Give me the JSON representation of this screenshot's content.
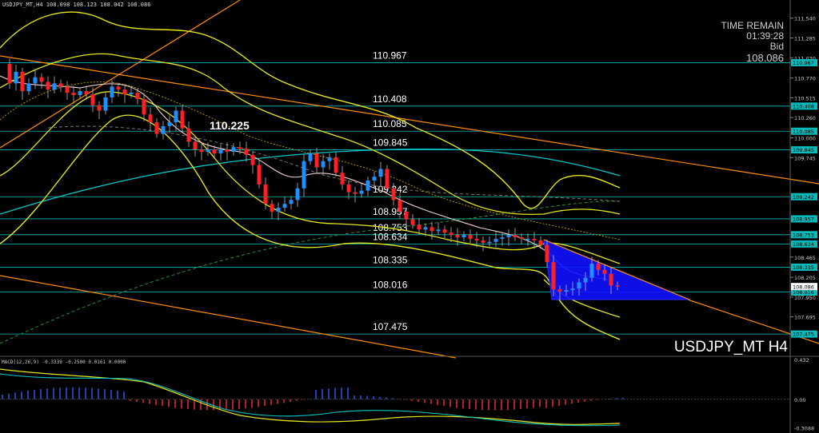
{
  "window": {
    "header": "USDJPY_MT,H4  108.098 108.123 108.042 108.086",
    "symbol_label": "USDJPY_MT H4"
  },
  "info_box": {
    "line1": "TIME REMAIN",
    "line2": "01:39:28",
    "line3": "Bid",
    "line4": "108.086"
  },
  "colors": {
    "background": "#000000",
    "bull_candle": "#1e90ff",
    "bear_candle": "#ff2020",
    "level_line": "#00bcbc",
    "band": "#e6e619",
    "trend": "#ff8c00",
    "ma_slow": "#00c8c8",
    "triangle": "#1010ff",
    "macd_hist_pos": "#3060ff",
    "macd_hist_neg": "#ff3030"
  },
  "chart_data": {
    "type": "candlestick",
    "price_axis_ticks": [
      "111.540",
      "111.285",
      "111.030",
      "110.770",
      "110.515",
      "110.260",
      "110.000",
      "109.745",
      "108.465",
      "108.205",
      "107.950",
      "107.695"
    ],
    "price_range": [
      107.25,
      111.65
    ],
    "levels": [
      {
        "label": "110.967",
        "value": 110.967,
        "tag": "110.967"
      },
      {
        "label": "110.408",
        "value": 110.408,
        "tag": "110.408"
      },
      {
        "label": "110.085",
        "value": 110.085,
        "tag": "110.085"
      },
      {
        "label": "109.845",
        "value": 109.845,
        "tag": "109.845"
      },
      {
        "label": "109.242",
        "value": 109.242,
        "tag": "109.242"
      },
      {
        "label": "108.957",
        "value": 108.957,
        "tag": "108.957"
      },
      {
        "label": "108.753",
        "value": 108.753,
        "tag": "108.753"
      },
      {
        "label": "108.634",
        "value": 108.634,
        "tag": "108.634"
      },
      {
        "label": "108.335",
        "value": 108.335,
        "tag": "108.335"
      },
      {
        "label": "108.016",
        "value": 108.016,
        "tag": "108.016"
      },
      {
        "label": "107.475",
        "value": 107.475,
        "tag": "107.475"
      }
    ],
    "annotation": {
      "text": "110.225",
      "value": 110.225
    },
    "current_price": {
      "value": 108.086,
      "tag": "108.086"
    },
    "macd": {
      "label": "MACD(12,26,9) -0.3339 -0.2500 0.0161 0.0000",
      "ticks": [
        "0.432",
        "0.00",
        "-0.3088"
      ],
      "range": [
        -0.35,
        0.45
      ]
    }
  }
}
